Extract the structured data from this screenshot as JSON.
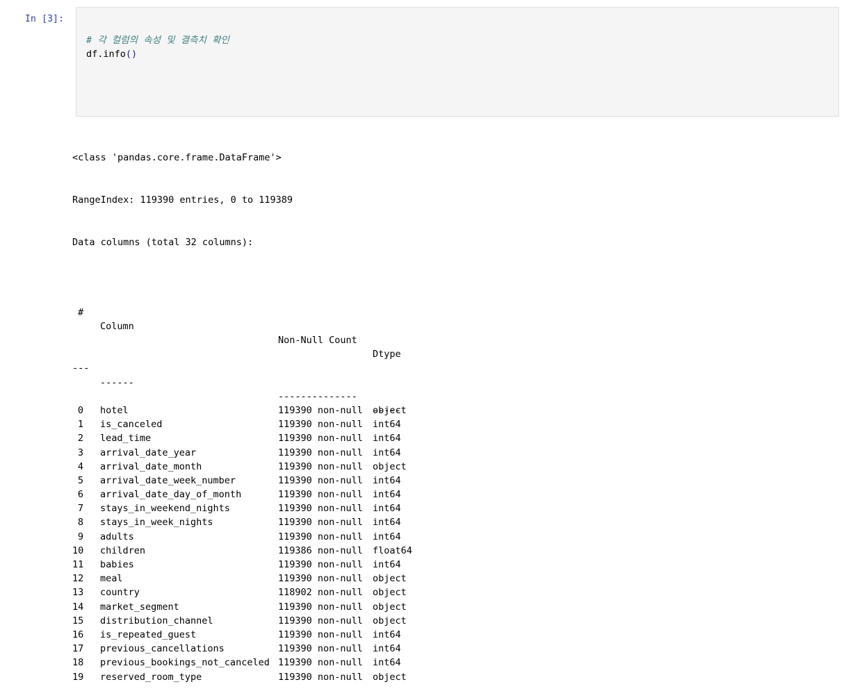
{
  "cell": {
    "prompt": "In [3]:",
    "code_comment": "# 각 컬럼의 속성 및 결측치 확인",
    "code_call_prefix": "df.info",
    "code_call_parens": "()"
  },
  "output": {
    "line1": "<class 'pandas.core.frame.DataFrame'>",
    "line2": "RangeIndex: 119390 entries, 0 to 119389",
    "line3": "Data columns (total 32 columns):",
    "header": {
      "idx": "#",
      "column": "Column",
      "non_null": "Non-Null Count",
      "dtype": "Dtype"
    },
    "separator": {
      "idx": "---",
      "column": "------",
      "non_null": "--------------",
      "dtype": "-----"
    },
    "rows": [
      {
        "idx": "0",
        "column": "hotel",
        "non_null": "119390 non-null",
        "dtype": "object"
      },
      {
        "idx": "1",
        "column": "is_canceled",
        "non_null": "119390 non-null",
        "dtype": "int64"
      },
      {
        "idx": "2",
        "column": "lead_time",
        "non_null": "119390 non-null",
        "dtype": "int64"
      },
      {
        "idx": "3",
        "column": "arrival_date_year",
        "non_null": "119390 non-null",
        "dtype": "int64"
      },
      {
        "idx": "4",
        "column": "arrival_date_month",
        "non_null": "119390 non-null",
        "dtype": "object"
      },
      {
        "idx": "5",
        "column": "arrival_date_week_number",
        "non_null": "119390 non-null",
        "dtype": "int64"
      },
      {
        "idx": "6",
        "column": "arrival_date_day_of_month",
        "non_null": "119390 non-null",
        "dtype": "int64"
      },
      {
        "idx": "7",
        "column": "stays_in_weekend_nights",
        "non_null": "119390 non-null",
        "dtype": "int64"
      },
      {
        "idx": "8",
        "column": "stays_in_week_nights",
        "non_null": "119390 non-null",
        "dtype": "int64"
      },
      {
        "idx": "9",
        "column": "adults",
        "non_null": "119390 non-null",
        "dtype": "int64"
      },
      {
        "idx": "10",
        "column": "children",
        "non_null": "119386 non-null",
        "dtype": "float64"
      },
      {
        "idx": "11",
        "column": "babies",
        "non_null": "119390 non-null",
        "dtype": "int64"
      },
      {
        "idx": "12",
        "column": "meal",
        "non_null": "119390 non-null",
        "dtype": "object"
      },
      {
        "idx": "13",
        "column": "country",
        "non_null": "118902 non-null",
        "dtype": "object"
      },
      {
        "idx": "14",
        "column": "market_segment",
        "non_null": "119390 non-null",
        "dtype": "object"
      },
      {
        "idx": "15",
        "column": "distribution_channel",
        "non_null": "119390 non-null",
        "dtype": "object"
      },
      {
        "idx": "16",
        "column": "is_repeated_guest",
        "non_null": "119390 non-null",
        "dtype": "int64"
      },
      {
        "idx": "17",
        "column": "previous_cancellations",
        "non_null": "119390 non-null",
        "dtype": "int64"
      },
      {
        "idx": "18",
        "column": "previous_bookings_not_canceled",
        "non_null": "119390 non-null",
        "dtype": "int64"
      },
      {
        "idx": "19",
        "column": "reserved_room_type",
        "non_null": "119390 non-null",
        "dtype": "object"
      }
    ]
  }
}
